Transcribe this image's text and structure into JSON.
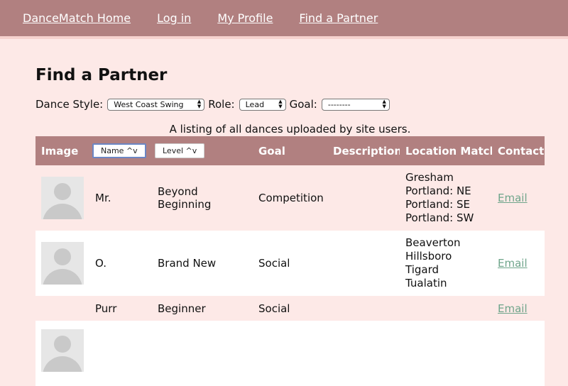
{
  "nav": {
    "home": "DanceMatch Home",
    "login": "Log in",
    "profile": "My Profile",
    "find": "Find a Partner"
  },
  "page_title": "Find a Partner",
  "filters": {
    "style_label": "Dance Style:",
    "style_value": "West Coast Swing",
    "role_label": "Role:",
    "role_value": "Lead",
    "goal_label": "Goal:",
    "goal_value": "--------"
  },
  "caption": "A listing of all dances uploaded by site users.",
  "table": {
    "headers": {
      "image": "Image",
      "name": "Name ^v",
      "level": "Level ^v",
      "goal": "Goal",
      "description": "Description",
      "location": "Location Match",
      "contact": "Contact"
    },
    "rows": [
      {
        "name": "Mr.",
        "level": "Beyond Beginning",
        "goal": "Competition",
        "description": "",
        "locations": [
          "Gresham",
          "Portland: NE",
          "Portland: SE",
          "Portland: SW"
        ],
        "contact": "Email"
      },
      {
        "name": "O.",
        "level": "Brand New",
        "goal": "Social",
        "description": "",
        "locations": [
          "Beaverton",
          "Hillsboro",
          "Tigard",
          "Tualatin"
        ],
        "contact": "Email"
      },
      {
        "name": "Purr",
        "level": "Beginner",
        "goal": "Social",
        "description": "",
        "locations": [],
        "contact": "Email"
      }
    ]
  }
}
